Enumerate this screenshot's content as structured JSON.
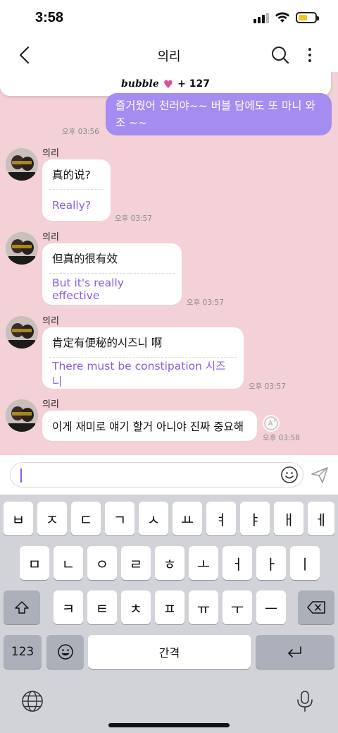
{
  "status_bar": {
    "time": "3:58"
  },
  "nav": {
    "title": "의리",
    "icons": [
      "back-chevron-icon",
      "search-icon",
      "more-vertical-icon"
    ]
  },
  "banner": {
    "logo": "bubble",
    "heart": "♥",
    "count": "+ 127"
  },
  "sent_message": {
    "text": "즐거웠어 천러야~~ 버블 담에도 또 마니 와조 ~~",
    "time": "오후 03:56"
  },
  "received_messages": [
    {
      "sender": "의리",
      "original": "真的说?",
      "translation": "Really?",
      "time": "오후 03:57"
    },
    {
      "sender": "의리",
      "original": "但真的很有效",
      "translation": "But it's really effective",
      "time": "오후 03:57"
    },
    {
      "sender": "의리",
      "original": "肯定有便秘的시즈니 啊",
      "translation": "There must be constipation 시즈니",
      "time": "오후 03:57"
    },
    {
      "sender": "의리",
      "original": "이게 재미로 얘기 할거 아니야 진짜 중요해",
      "translation": "",
      "time": "오후 03:58"
    }
  ],
  "input": {
    "value": "",
    "icons": [
      "emoji-icon",
      "send-icon"
    ]
  },
  "keyboard": {
    "row1": [
      "ㅂ",
      "ㅈ",
      "ㄷ",
      "ㄱ",
      "ㅅ",
      "ㅛ",
      "ㅕ",
      "ㅑ",
      "ㅐ",
      "ㅔ"
    ],
    "row2": [
      "ㅁ",
      "ㄴ",
      "ㅇ",
      "ㄹ",
      "ㅎ",
      "ㅗ",
      "ㅓ",
      "ㅏ",
      "ㅣ"
    ],
    "row3": [
      "ㅋ",
      "ㅌ",
      "ㅊ",
      "ㅍ",
      "ㅠ",
      "ㅜ",
      "ㅡ"
    ],
    "numbers_label": "123",
    "space_label": "간격"
  },
  "colors": {
    "chat_background": "#f3d1d6",
    "sent_bubble": "#a48cf0",
    "translation_text": "#8a5ce6",
    "heart": "#e04f8e"
  }
}
